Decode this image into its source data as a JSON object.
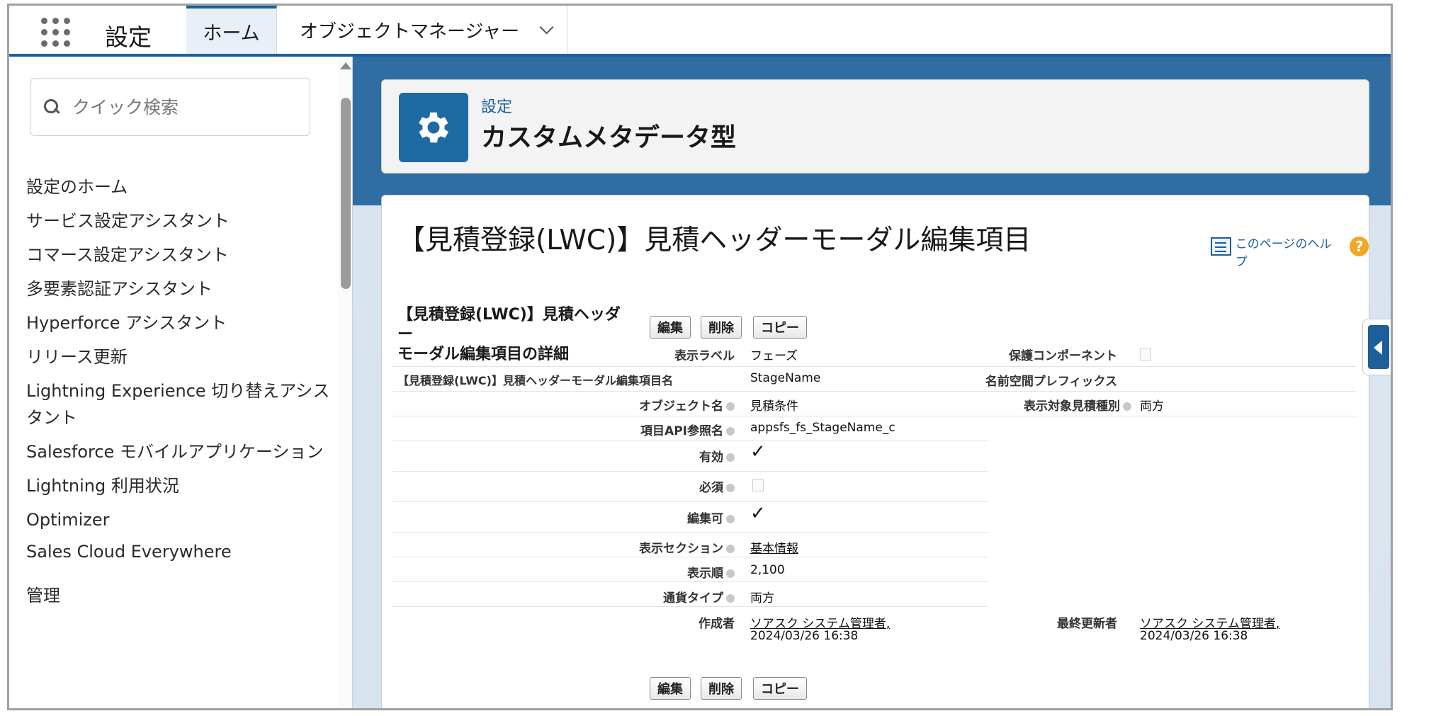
{
  "topbar": {
    "app_name": "設定",
    "tab_home": "ホーム",
    "tab_object_manager": "オブジェクトマネージャー"
  },
  "sidebar": {
    "search_placeholder": "クイック検索",
    "items": [
      "設定のホーム",
      "サービス設定アシスタント",
      "コマース設定アシスタント",
      "多要素認証アシスタント",
      "Hyperforce アシスタント",
      "リリース更新",
      "Lightning Experience 切り替えアシス",
      "タント",
      "Salesforce モバイルアプリケーション",
      "Lightning 利用状況",
      "Optimizer",
      "Sales Cloud Everywhere",
      "管理"
    ]
  },
  "header": {
    "breadcrumb": "設定",
    "title": "カスタムメタデータ型",
    "icon": "gear-icon"
  },
  "record": {
    "title": "【見積登録(LWC)】見積ヘッダーモーダル編集項目",
    "help_text": "このページのヘルプ",
    "section_heading_line1": "【見積登録(LWC)】見積ヘッダー",
    "section_heading_line2": "モーダル編集項目の詳細",
    "buttons": {
      "edit": "編集",
      "delete": "削除",
      "copy": "コピー"
    },
    "fields": {
      "label_label": "表示ラベル",
      "label_value": "フェーズ",
      "protected_label": "保護コンポーネント",
      "name_label": "【見積登録(LWC)】見積ヘッダーモーダル編集項目名",
      "name_value": "StageName",
      "ns_label": "名前空間プレフィックス",
      "object_label": "オブジェクト名",
      "object_value": "見積条件",
      "target_label": "表示対象見積種別",
      "target_value": "両方",
      "api_label": "項目API参照名",
      "api_value": "appsfs_fs_StageName_c",
      "active_label": "有効",
      "required_label": "必須",
      "editable_label": "編集可",
      "section_label": "表示セクション",
      "section_value": "基本情報",
      "order_label": "表示順",
      "order_value": "2,100",
      "currency_label": "通貨タイプ",
      "currency_value": "両方",
      "created_label": "作成者",
      "created_by": "ソアスク システム管理者",
      "created_date": "2024/03/26 16:38",
      "modified_label": "最終更新者",
      "modified_by": "ソアスク システム管理者",
      "modified_date": "2024/03/26 16:38"
    }
  },
  "colors": {
    "brand_blue": "#1b5f9e",
    "header_icon_bg": "#1d6aa5",
    "help_icon": "#f1a824"
  }
}
